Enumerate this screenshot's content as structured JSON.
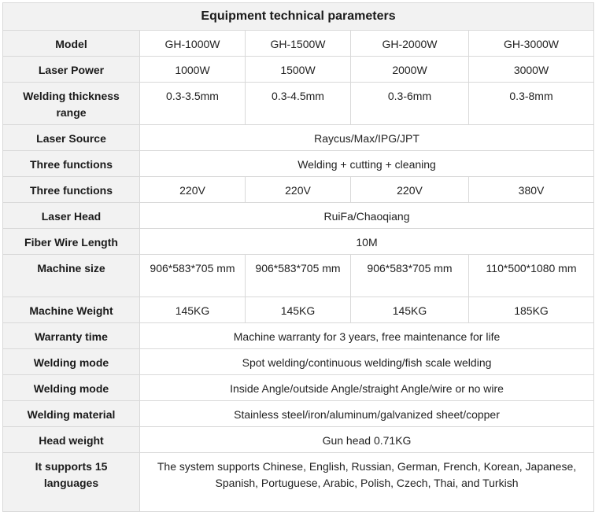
{
  "title": "Equipment technical parameters",
  "rows": {
    "model": {
      "label": "Model",
      "values": [
        "GH-1000W",
        "GH-1500W",
        "GH-2000W",
        "GH-3000W"
      ]
    },
    "laser_power": {
      "label": "Laser Power",
      "values": [
        "1000W",
        "1500W",
        "2000W",
        "3000W"
      ]
    },
    "welding_thickness": {
      "label": "Welding thickness range",
      "values": [
        "0.3-3.5mm",
        "0.3-4.5mm",
        "0.3-6mm",
        "0.3-8mm"
      ]
    },
    "laser_source": {
      "label": "Laser Source",
      "value": "Raycus/Max/IPG/JPT"
    },
    "three_functions": {
      "label": "Three functions",
      "value": "Welding + cutting + cleaning"
    },
    "voltage": {
      "label": "Three functions",
      "values": [
        "220V",
        "220V",
        "220V",
        "380V"
      ]
    },
    "laser_head": {
      "label": "Laser Head",
      "value": "RuiFa/Chaoqiang"
    },
    "fiber_wire_length": {
      "label": "Fiber Wire Length",
      "value": "10M"
    },
    "machine_size": {
      "label": "Machine size",
      "values": [
        "906*583*705 mm",
        "906*583*705 mm",
        "906*583*705 mm",
        "110*500*1080 mm"
      ]
    },
    "machine_weight": {
      "label": "Machine Weight",
      "values": [
        "145KG",
        "145KG",
        "145KG",
        "185KG"
      ]
    },
    "warranty": {
      "label": "Warranty time",
      "value": "Machine warranty for 3 years, free maintenance for life"
    },
    "welding_mode_1": {
      "label": "Welding mode",
      "value": "Spot welding/continuous welding/fish scale welding"
    },
    "welding_mode_2": {
      "label": "Welding mode",
      "value": "Inside Angle/outside Angle/straight Angle/wire or no wire"
    },
    "welding_material": {
      "label": "Welding material",
      "value": "Stainless steel/iron/aluminum/galvanized sheet/copper"
    },
    "head_weight": {
      "label": "Head weight",
      "value": "Gun head 0.71KG"
    },
    "languages": {
      "label": "It supports 15 languages",
      "value": "The system supports Chinese, English, Russian, German, French, Korean, Japanese, Spanish, Portuguese, Arabic, Polish, Czech, Thai, and Turkish"
    }
  }
}
